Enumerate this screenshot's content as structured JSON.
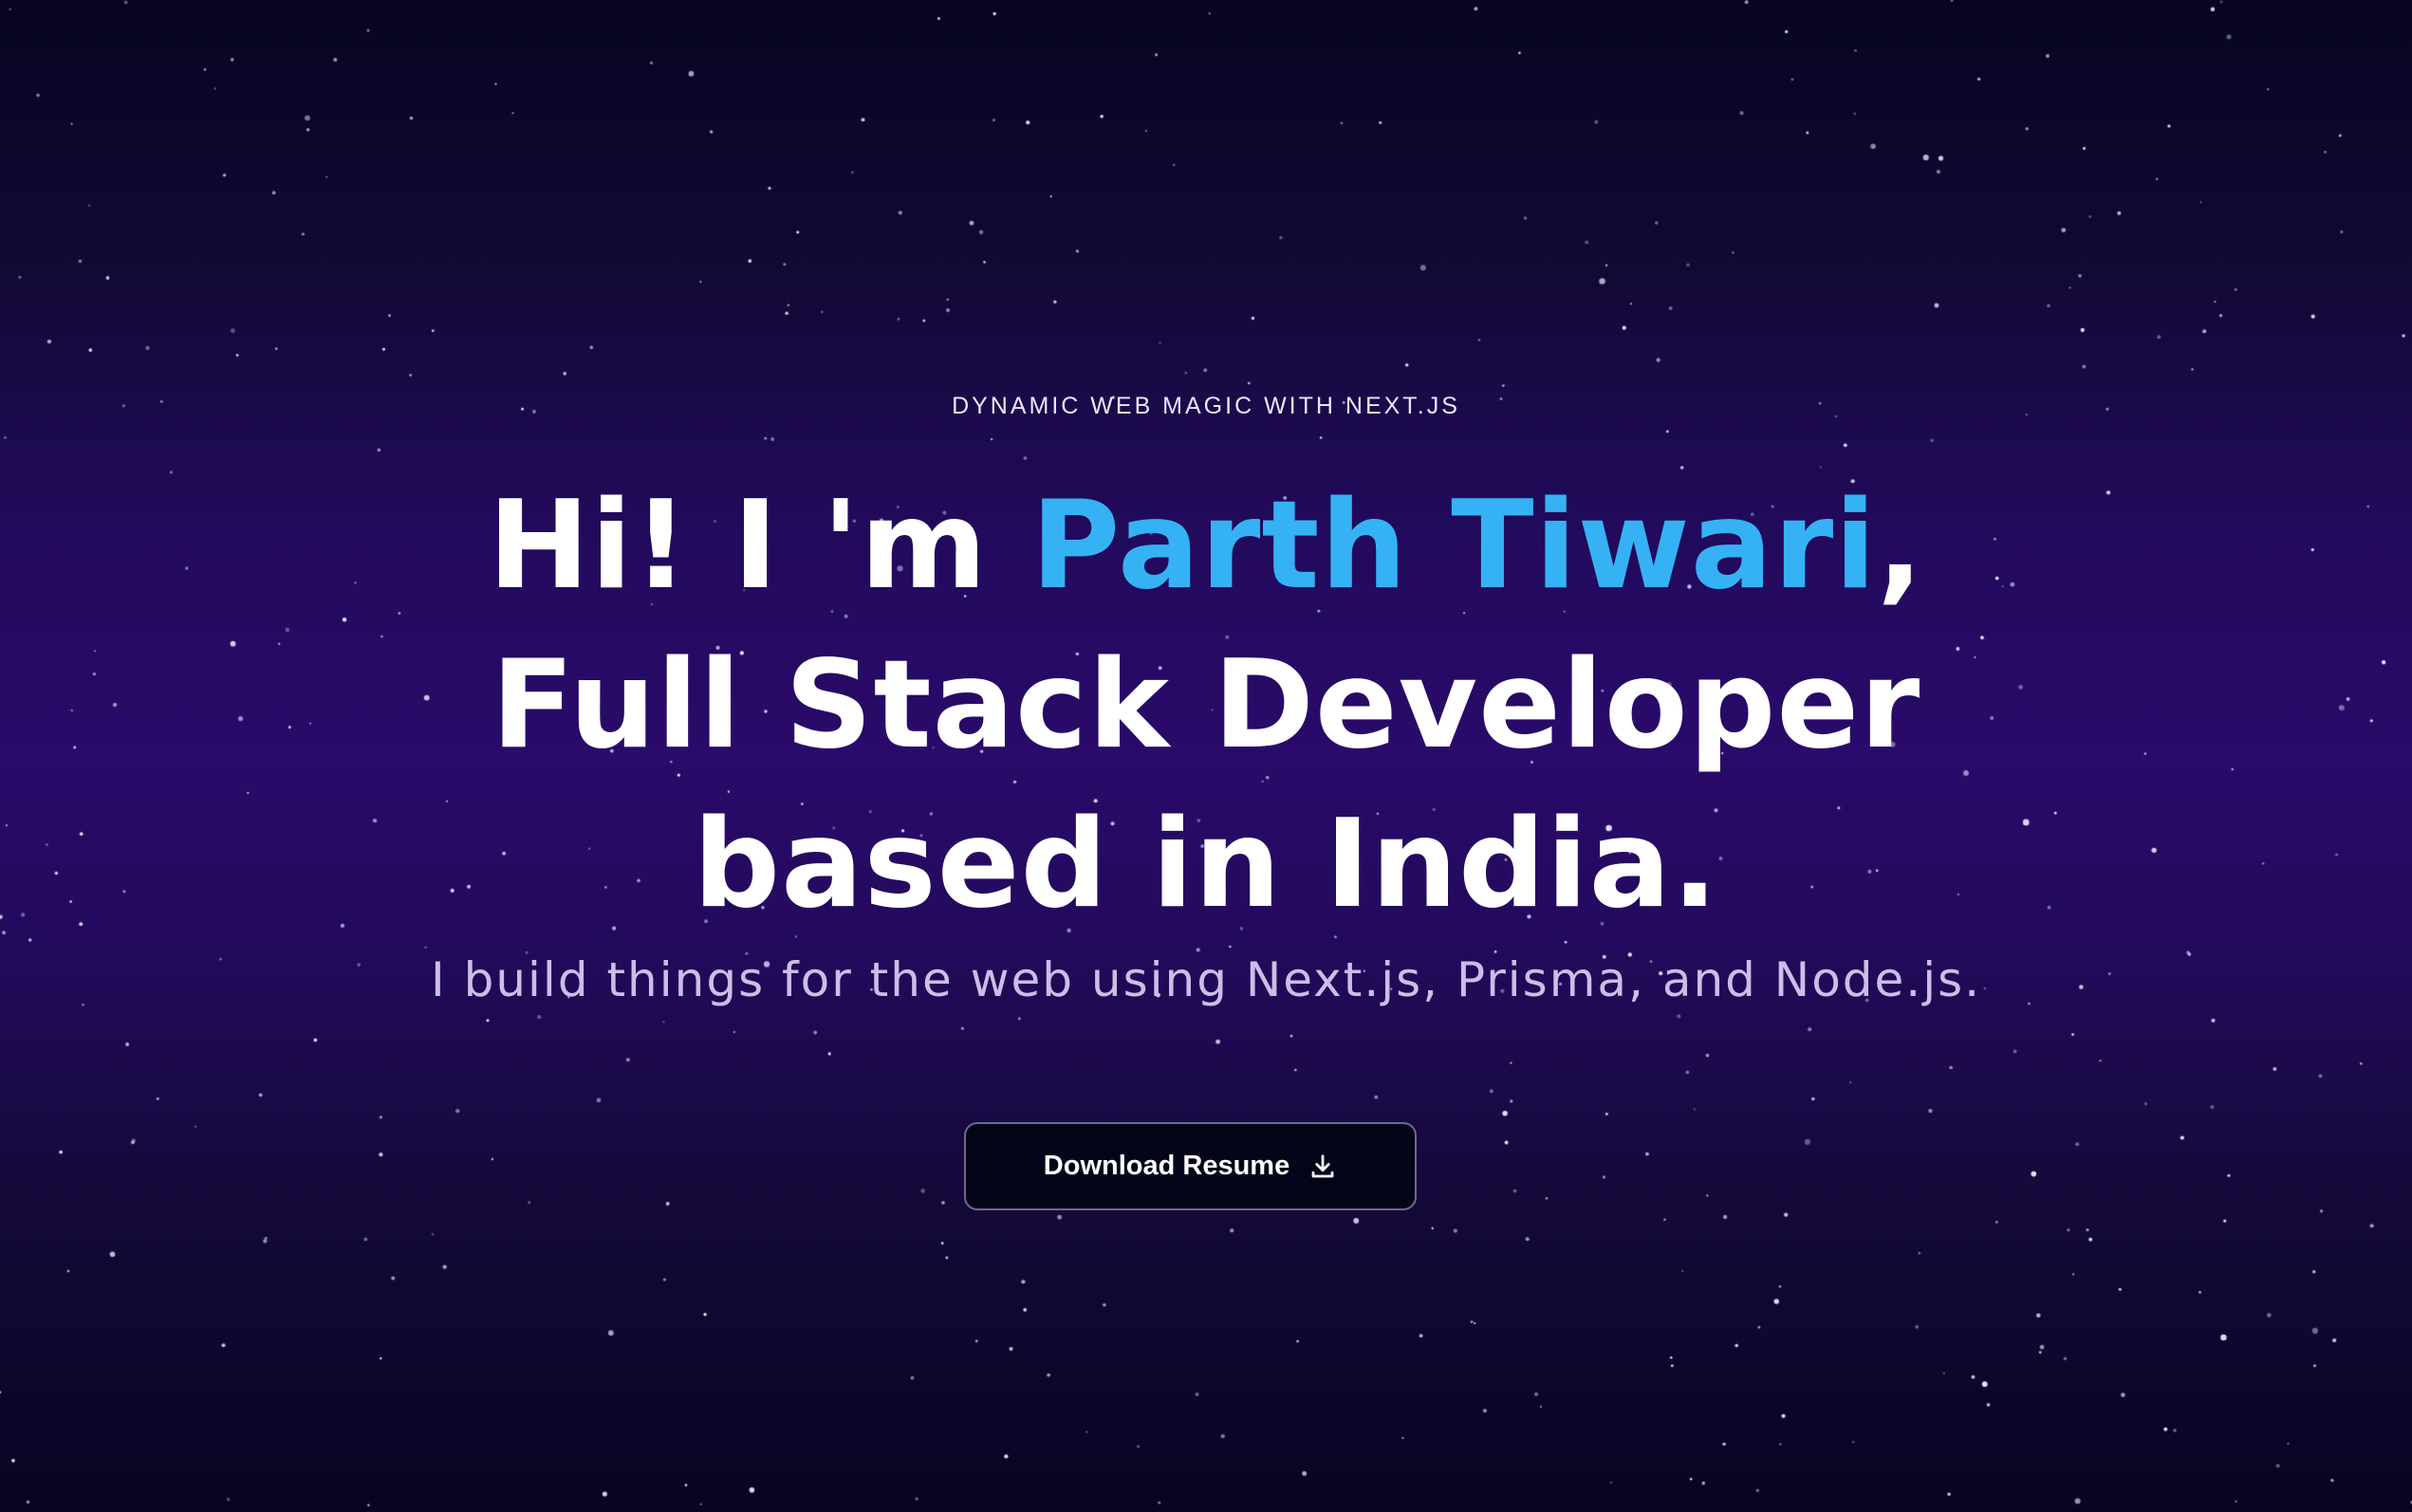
{
  "hero": {
    "eyebrow": "DYNAMIC WEB MAGIC WITH NEXT.JS",
    "headline_before": "Hi! I 'm ",
    "headline_name": "Parth Tiwari",
    "headline_after": ", Full Stack Developer based in India.",
    "subline": "I build things for the web using Next.js, Prisma, and Node.js.",
    "cta_label": "Download Resume",
    "cta_icon": "download-icon"
  },
  "colors": {
    "background_top": "#070522",
    "background_mid": "#2a0a6a",
    "accent": "#35b2f4",
    "text": "#ffffff",
    "subline_text": "#cdbde8",
    "button_bg": "#05051a",
    "button_border": "#6b6a8c"
  }
}
